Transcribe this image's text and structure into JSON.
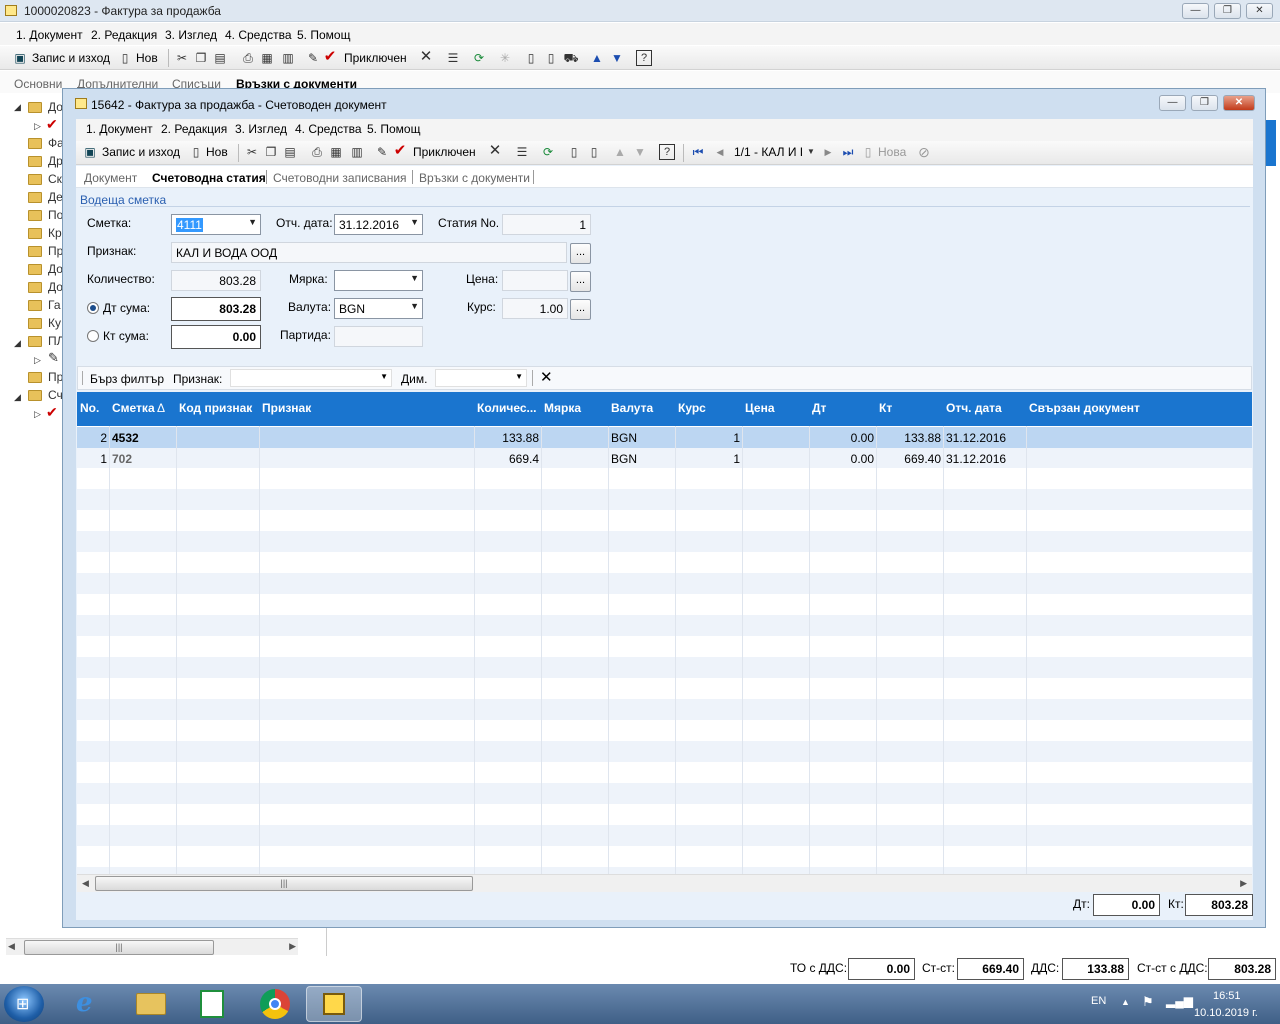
{
  "outer": {
    "title": "1000020823 - Фактура за продажба",
    "menu": [
      "1. Документ",
      "2. Редакция",
      "3. Изглед",
      "4. Средства",
      "5. Помощ"
    ],
    "toolbar": {
      "save_exit": "Запис и изход",
      "new": "Нов",
      "posted": "Приключен"
    },
    "tabs": [
      "Основни",
      "Допълнителни",
      "Списъци",
      "Връзки с документи"
    ],
    "tree_items": [
      "До",
      "Фа",
      "Др",
      "Ск",
      "Де",
      "По",
      "Кр",
      "Пр",
      "До",
      "До",
      "Га",
      "Ку",
      "ПЛ",
      "Пр",
      "Сч"
    ],
    "totals": {
      "to_vat_label": "ТО с ДДС:",
      "to_vat": "0.00",
      "net_label": "Ст-ст:",
      "net": "669.40",
      "vat_label": "ДДС:",
      "vat": "133.88",
      "gross_label": "Ст-ст с ДДС:",
      "gross": "803.28"
    }
  },
  "dialog": {
    "title": "15642 - Фактура за продажба - Счетоводен документ",
    "menu": [
      "1. Документ",
      "2. Редакция",
      "3. Изглед",
      "4. Средства",
      "5. Помощ"
    ],
    "toolbar": {
      "save_exit": "Запис и изход",
      "new": "Нов",
      "posted": "Приключен",
      "nav": "1/1 - КАЛ И І",
      "new_record": "Нова"
    },
    "tabs": [
      "Документ",
      "Счетоводна статия",
      "Счетоводни записвания",
      "Връзки с документи"
    ],
    "section": "Водеща сметка",
    "form": {
      "account_label": "Сметка:",
      "account": "4111",
      "date_label": "Отч. дата:",
      "date": "31.12.2016",
      "entry_no_label": "Статия No.",
      "entry_no": "1",
      "feature_label": "Признак:",
      "feature": "КАЛ И ВОДА ООД",
      "qty_label": "Количество:",
      "qty": "803.28",
      "measure_label": "Мярка:",
      "measure": "",
      "price_label": "Цена:",
      "price": "",
      "debit_label": "Дт сума:",
      "debit": "803.28",
      "currency_label": "Валута:",
      "currency": "BGN",
      "rate_label": "Курс:",
      "rate": "1.00",
      "credit_label": "Кт сума:",
      "credit": "0.00",
      "batch_label": "Партида:",
      "batch": "",
      "debit_selected": true
    },
    "filter": {
      "quick": "Бърз филтър",
      "feature_label": "Признак:",
      "dim_label": "Дим."
    },
    "grid": {
      "columns": [
        "No.",
        "Сметка",
        "Код признак",
        "Признак",
        "Количес...",
        "Мярка",
        "Валута",
        "Курс",
        "Цена",
        "Дт",
        "Кт",
        "Отч. дата",
        "Свързан документ"
      ],
      "sort_indicator": "Δ",
      "rows": [
        {
          "no": "2",
          "account": "4532",
          "code": "",
          "feature": "",
          "qty": "133.88",
          "measure": "",
          "currency": "BGN",
          "rate": "1",
          "price": "",
          "dt": "0.00",
          "kt": "133.88",
          "date": "31.12.2016",
          "doc": ""
        },
        {
          "no": "1",
          "account": "702",
          "code": "",
          "feature": "",
          "qty": "669.4",
          "measure": "",
          "currency": "BGN",
          "rate": "1",
          "price": "",
          "dt": "0.00",
          "kt": "669.40",
          "date": "31.12.2016",
          "doc": ""
        }
      ]
    },
    "totals": {
      "dt_label": "Дт:",
      "dt": "0.00",
      "kt_label": "Кт:",
      "kt": "803.28"
    }
  },
  "taskbar": {
    "lang": "EN",
    "time": "16:51",
    "date": "10.10.2019 г."
  }
}
